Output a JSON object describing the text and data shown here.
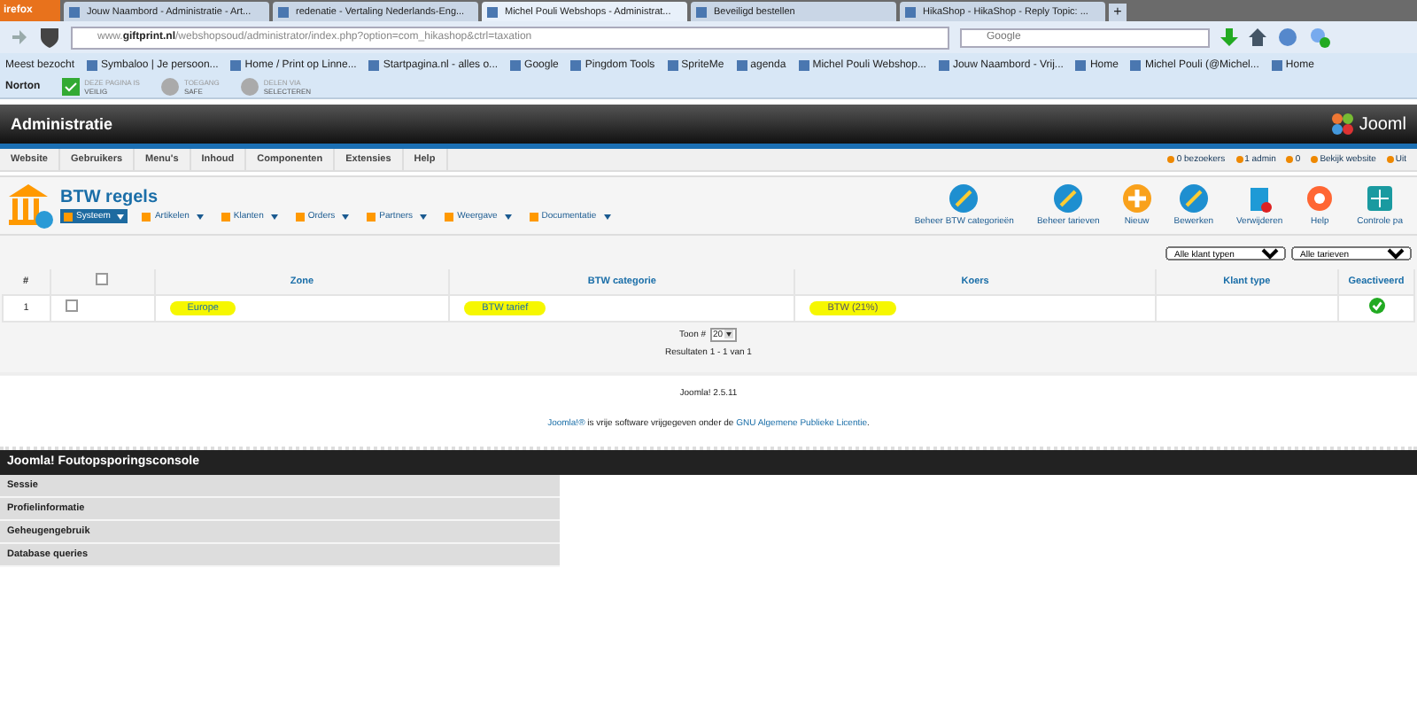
{
  "browser": {
    "menu_button": "irefox",
    "tabs": [
      {
        "title": "Jouw Naambord - Administratie - Art...",
        "selected": false
      },
      {
        "title": "redenatie - Vertaling Nederlands-Eng...",
        "selected": false
      },
      {
        "title": "Michel Pouli Webshops - Administrat...",
        "selected": true
      },
      {
        "title": "Beveiligd bestellen",
        "selected": false
      },
      {
        "title": "HikaShop - HikaShop - Reply Topic: ...",
        "selected": false
      }
    ],
    "new_tab": "+",
    "url_host_prefix": "www.",
    "url_host": "giftprint.nl",
    "url_path": "/webshopsoud/administrator/index.php?option=com_hikashop&ctrl=taxation",
    "search_placeholder": "Google",
    "bookmarks": [
      "Meest bezocht",
      "Symbaloo | Je persoon...",
      "Home / Print op Linne...",
      "Startpagina.nl - alles o...",
      "Google",
      "Pingdom Tools",
      "SpriteMe",
      "agenda",
      "Michel Pouli Webshop...",
      "Jouw Naambord - Vrij...",
      "Home",
      "Michel Pouli (@Michel...",
      "Home"
    ],
    "norton": {
      "label": "Norton",
      "items": [
        {
          "top": "DEZE PAGINA IS",
          "bottom": "VEILIG"
        },
        {
          "top": "TOEGANG",
          "bottom": "SAFE"
        },
        {
          "top": "DELEN VIA",
          "bottom": "SELECTEREN"
        }
      ]
    }
  },
  "admin": {
    "title": "Administratie",
    "logo": "Jooml",
    "menu": [
      "Website",
      "Gebruikers",
      "Menu's",
      "Inhoud",
      "Componenten",
      "Extensies",
      "Help"
    ],
    "status": [
      "0 bezoekers",
      "1 admin",
      "0",
      "Bekijk website",
      "Uit"
    ],
    "page_title": "BTW regels",
    "submenu": [
      {
        "label": "Systeem",
        "selected": true
      },
      {
        "label": "Artikelen",
        "selected": false
      },
      {
        "label": "Klanten",
        "selected": false
      },
      {
        "label": "Orders",
        "selected": false
      },
      {
        "label": "Partners",
        "selected": false
      },
      {
        "label": "Weergave",
        "selected": false
      },
      {
        "label": "Documentatie",
        "selected": false
      }
    ],
    "toolbar": [
      {
        "label": "Beheer BTW categorieën",
        "kind": "edit"
      },
      {
        "label": "Beheer tarieven",
        "kind": "edit"
      },
      {
        "label": "Nieuw",
        "kind": "new"
      },
      {
        "label": "Bewerken",
        "kind": "edit"
      },
      {
        "label": "Verwijderen",
        "kind": "delete"
      },
      {
        "label": "Help",
        "kind": "help"
      },
      {
        "label": "Controle pa",
        "kind": "panel"
      }
    ],
    "filters": [
      "Alle klant typen",
      "Alle tarieven"
    ],
    "table": {
      "all_checked": false,
      "columns": [
        "#",
        "Zone",
        "BTW categorie",
        "Koers",
        "Klant type",
        "Geactiveerd"
      ],
      "rows": [
        {
          "number": "1",
          "checked": false,
          "zone": {
            "text": "Europe",
            "highlighted": true
          },
          "category": {
            "text": "BTW tarief",
            "highlighted": true
          },
          "rate": {
            "text": "BTW (21%)",
            "highlighted": true
          },
          "active": true
        }
      ]
    },
    "pagination": {
      "label": "Toon #",
      "value": "20",
      "results": "Resultaten 1 - 1 van 1"
    },
    "version": "Joomla! 2.5.11",
    "license": [
      {
        "text": "Joomla!®",
        "kind": "link"
      },
      {
        "text": " is vrije software vrijgegeven onder de ",
        "kind": "text"
      },
      {
        "text": "GNU Algemene Publieke Licentie",
        "kind": "link"
      },
      {
        "text": ".",
        "kind": "text"
      }
    ]
  },
  "debug": {
    "title": "Joomla! Foutopsporingsconsole",
    "items": [
      "Sessie",
      "Profielinformatie",
      "Geheugengebruik",
      "Database queries"
    ]
  }
}
